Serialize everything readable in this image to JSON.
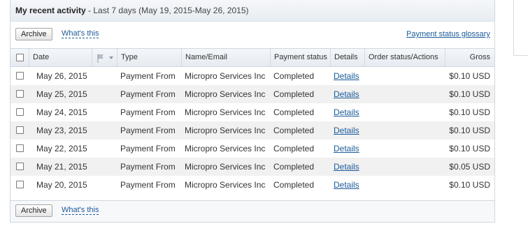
{
  "activity": {
    "title": "My recent activity",
    "range": " - Last 7 days (May 19, 2015-May 26, 2015)"
  },
  "toolbar": {
    "archive_label": "Archive",
    "whats_this_label": "What's this",
    "glossary_label": "Payment status glossary"
  },
  "columns": {
    "date": "Date",
    "type": "Type",
    "name_email": "Name/Email",
    "payment_status": "Payment status",
    "details": "Details",
    "order_status": "Order status/Actions",
    "gross": "Gross"
  },
  "icons": {
    "flag": "flag-icon",
    "dropdown": "chevron-down-icon"
  },
  "rows": [
    {
      "date": "May 26, 2015",
      "type": "Payment From",
      "name": "Micropro Services Inc",
      "status": "Completed",
      "details": "Details",
      "order_status": "",
      "gross": "$0.10 USD"
    },
    {
      "date": "May 25, 2015",
      "type": "Payment From",
      "name": "Micropro Services Inc",
      "status": "Completed",
      "details": "Details",
      "order_status": "",
      "gross": "$0.10 USD"
    },
    {
      "date": "May 24, 2015",
      "type": "Payment From",
      "name": "Micropro Services Inc",
      "status": "Completed",
      "details": "Details",
      "order_status": "",
      "gross": "$0.10 USD"
    },
    {
      "date": "May 23, 2015",
      "type": "Payment From",
      "name": "Micropro Services Inc",
      "status": "Completed",
      "details": "Details",
      "order_status": "",
      "gross": "$0.10 USD"
    },
    {
      "date": "May 22, 2015",
      "type": "Payment From",
      "name": "Micropro Services Inc",
      "status": "Completed",
      "details": "Details",
      "order_status": "",
      "gross": "$0.10 USD"
    },
    {
      "date": "May 21, 2015",
      "type": "Payment From",
      "name": "Micropro Services Inc",
      "status": "Completed",
      "details": "Details",
      "order_status": "",
      "gross": "$0.05 USD"
    },
    {
      "date": "May 20, 2015",
      "type": "Payment From",
      "name": "Micropro Services Inc",
      "status": "Completed",
      "details": "Details",
      "order_status": "",
      "gross": "$0.10 USD"
    }
  ],
  "colors": {
    "link": "#1a5a9a",
    "alt_row": "#f1f1f1",
    "header_bg": "#e8edf2"
  }
}
